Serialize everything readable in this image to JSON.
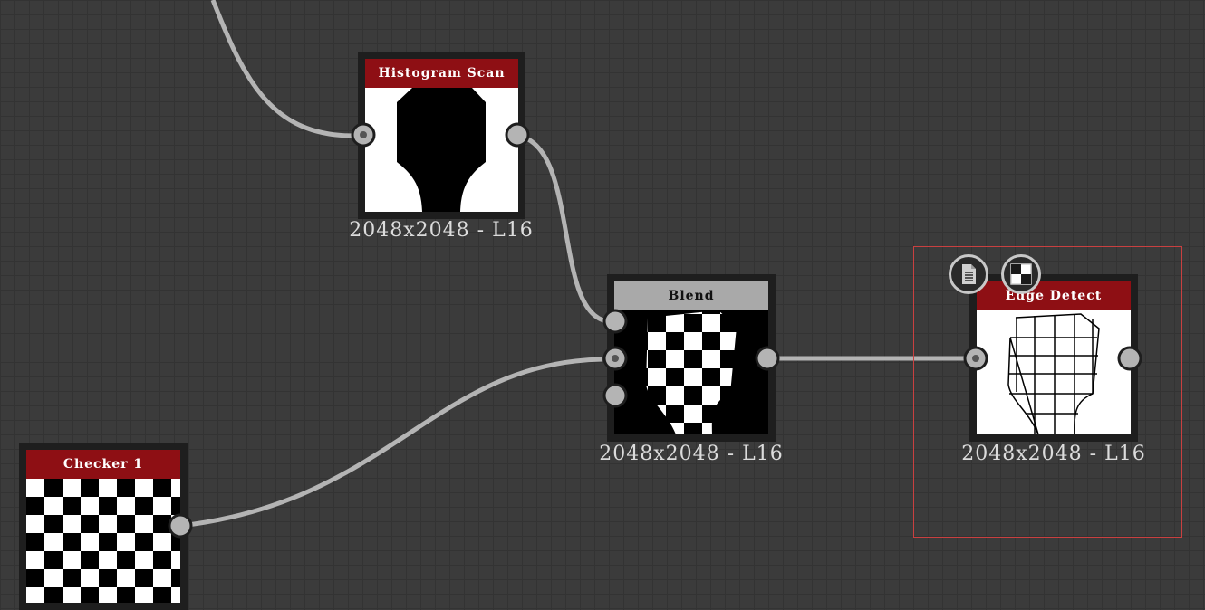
{
  "graph": {
    "nodes": {
      "histogram_scan": {
        "title": "Histogram Scan",
        "caption": "2048x2048 - L16",
        "header_color": "#8e0f14"
      },
      "blend": {
        "title": "Blend",
        "caption": "2048x2048 - L16",
        "header_color": "#a9a9a9"
      },
      "edge_detect": {
        "title": "Edge Detect",
        "caption": "2048x2048 - L16",
        "header_color": "#8e0f14"
      },
      "checker_1": {
        "title": "Checker 1",
        "header_color": "#8e0f14"
      }
    },
    "colors": {
      "canvas_bg": "#3b3b3b",
      "wire": "#b4b4b4",
      "selection": "#c94040",
      "port_fill": "#b4b4b4",
      "node_frame": "#1e1e1e"
    },
    "toolbar_icons": [
      "document-icon",
      "checker-preview-icon"
    ]
  }
}
